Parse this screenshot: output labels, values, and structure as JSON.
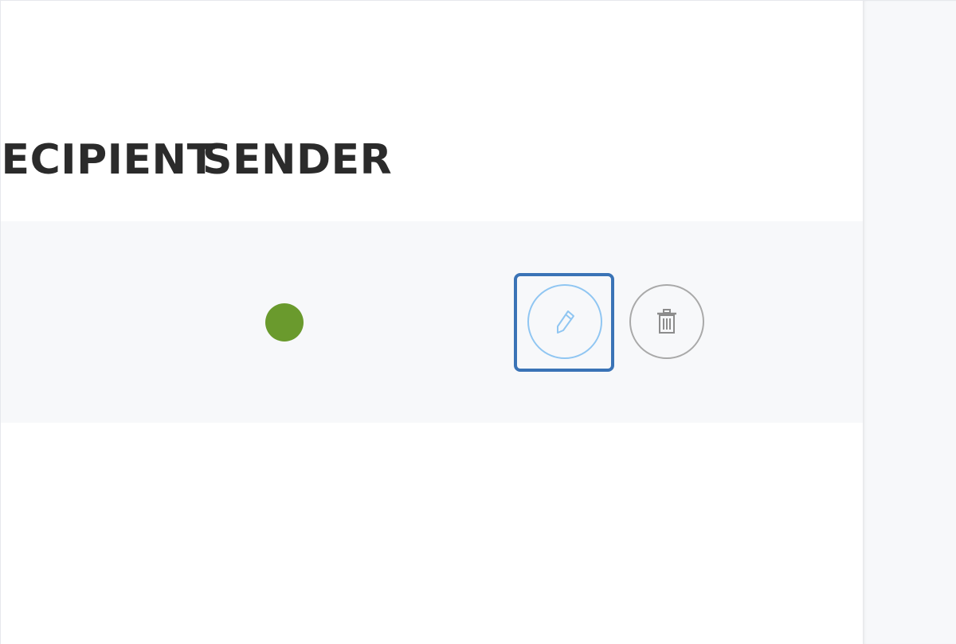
{
  "table": {
    "headers": {
      "recipient": "RECIPIENT",
      "sender": "SENDER"
    },
    "rows": [
      {
        "sender_status_color": "#6a9a2d",
        "actions": {
          "edit_icon": "pencil-icon",
          "delete_icon": "trash-icon"
        }
      }
    ]
  },
  "colors": {
    "row_background": "#f7f8fa",
    "highlight_border": "#3a73b6",
    "edit_button_border": "#90c6f2",
    "delete_button_border": "#a9a9a9"
  }
}
